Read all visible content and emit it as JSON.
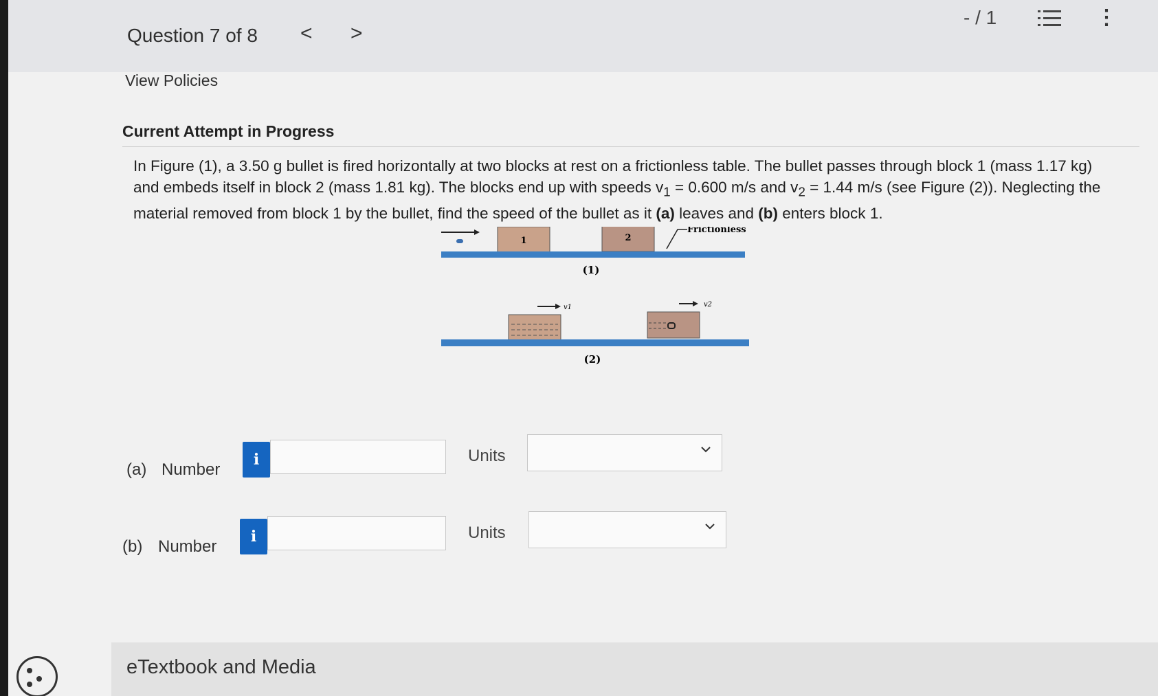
{
  "header": {
    "question_title": "Question 7 of 8",
    "prev": "<",
    "next": ">",
    "score": "- / 1",
    "more": "⋮"
  },
  "links": {
    "view_policies": "View Policies"
  },
  "attempt_heading": "Current Attempt in Progress",
  "problem": {
    "p1": "In Figure (1), a 3.50 g bullet is fired horizontally at two blocks at rest on a frictionless table. The bullet passes through block 1 (mass 1.17 kg) and embeds itself in block 2 (mass 1.81 kg). The blocks end up with speeds v",
    "sub1": "1",
    "p2": " = 0.600 m/s and v",
    "sub2": "2",
    "p3": " = 1.44 m/s (see Figure (2)). Neglecting the material removed from block 1 by the bullet, find the speed of the bullet as it ",
    "a": "(a)",
    "p4": " leaves and ",
    "b": "(b)",
    "p5": " enters block 1."
  },
  "figure": {
    "block1": "1",
    "block2": "2",
    "frictionless": "Frictionless",
    "cap1": "(1)",
    "cap2": "(2)",
    "v1": "v1",
    "v2": "v2"
  },
  "parts": [
    {
      "label": "(a)",
      "field": "Number",
      "info": "i",
      "value": "",
      "units_label": "Units",
      "units_value": ""
    },
    {
      "label": "(b)",
      "field": "Number",
      "info": "i",
      "value": "",
      "units_label": "Units",
      "units_value": ""
    }
  ],
  "footer": {
    "etextbook": "eTextbook and Media"
  },
  "colors": {
    "info_button": "#1565c0",
    "table": "#3b7fc4",
    "block": "#c9a28a"
  }
}
